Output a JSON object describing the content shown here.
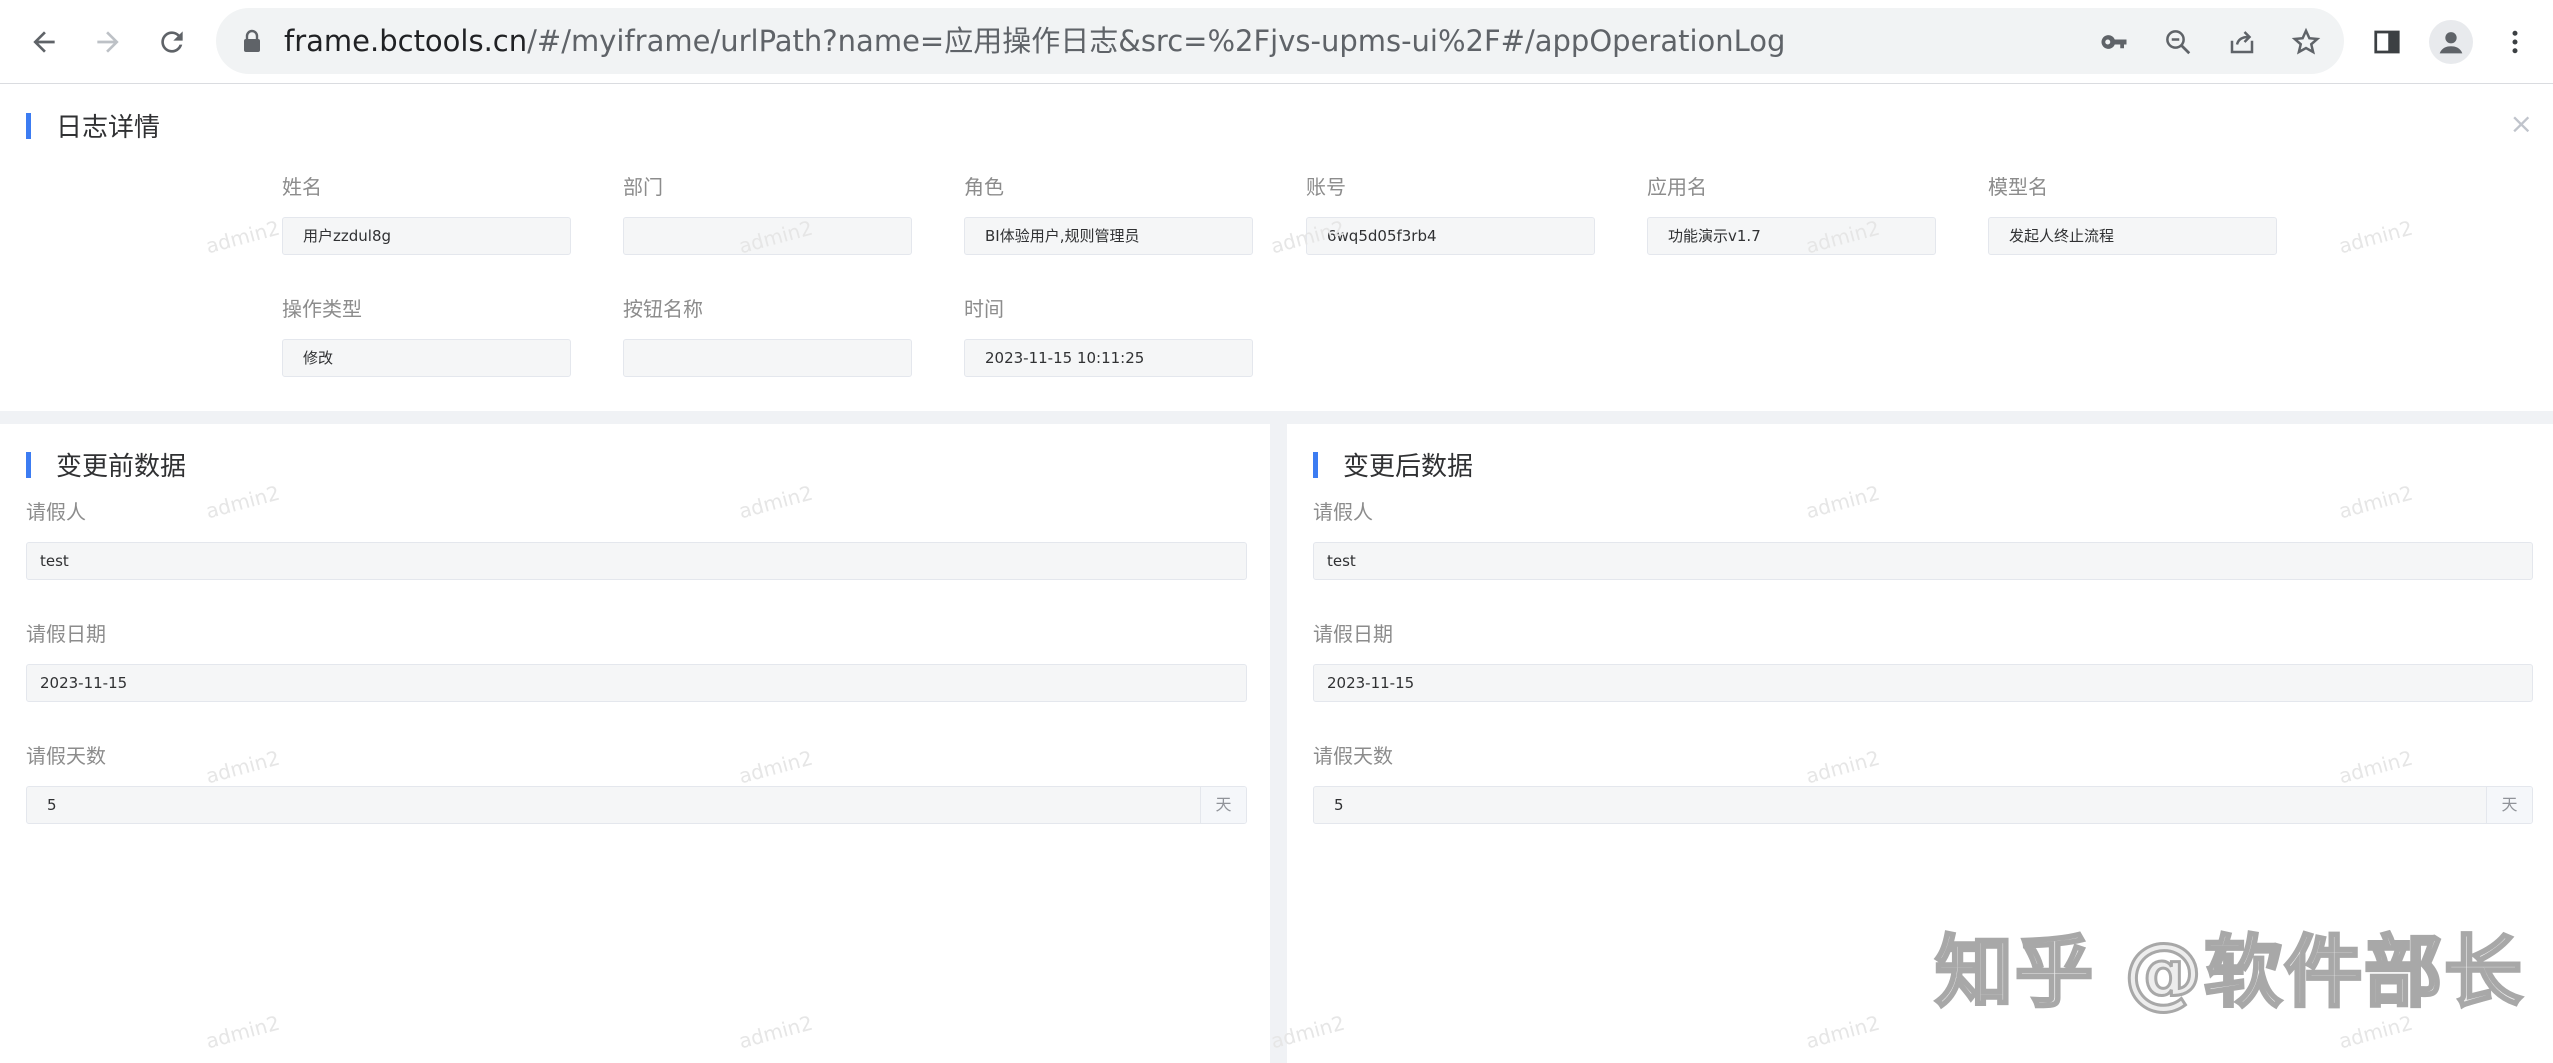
{
  "browser": {
    "url_host": "frame.bctools.cn",
    "url_path": "/#/myiframe/urlPath?name=应用操作日志&src=%2Fjvs-upms-ui%2F#/appOperationLog"
  },
  "detail": {
    "title": "日志详情",
    "close_label": "×",
    "fields": {
      "name": {
        "label": "姓名",
        "value": "用户zzdul8g"
      },
      "dept": {
        "label": "部门",
        "value": ""
      },
      "role": {
        "label": "角色",
        "value": "BI体验用户,规则管理员"
      },
      "account": {
        "label": "账号",
        "value": "6wq5d05f3rb4"
      },
      "app": {
        "label": "应用名",
        "value": "功能演示v1.7"
      },
      "model": {
        "label": "模型名",
        "value": "发起人终止流程"
      },
      "op_type": {
        "label": "操作类型",
        "value": "修改"
      },
      "button": {
        "label": "按钮名称",
        "value": ""
      },
      "time": {
        "label": "时间",
        "value": "2023-11-15 10:11:25"
      }
    }
  },
  "before": {
    "title": "变更前数据",
    "applicant": {
      "label": "请假人",
      "value": "test"
    },
    "date": {
      "label": "请假日期",
      "value": "2023-11-15"
    },
    "days": {
      "label": "请假天数",
      "value": "5",
      "unit": "天"
    }
  },
  "after": {
    "title": "变更后数据",
    "applicant": {
      "label": "请假人",
      "value": "test"
    },
    "date": {
      "label": "请假日期",
      "value": "2023-11-15"
    },
    "days": {
      "label": "请假天数",
      "value": "5",
      "unit": "天"
    }
  },
  "watermark": {
    "text": "admin2"
  },
  "site_watermark": {
    "text": "知乎 @软件部长"
  },
  "colors": {
    "accent": "#3c7cf2",
    "page_bg": "#f0f2f5"
  }
}
